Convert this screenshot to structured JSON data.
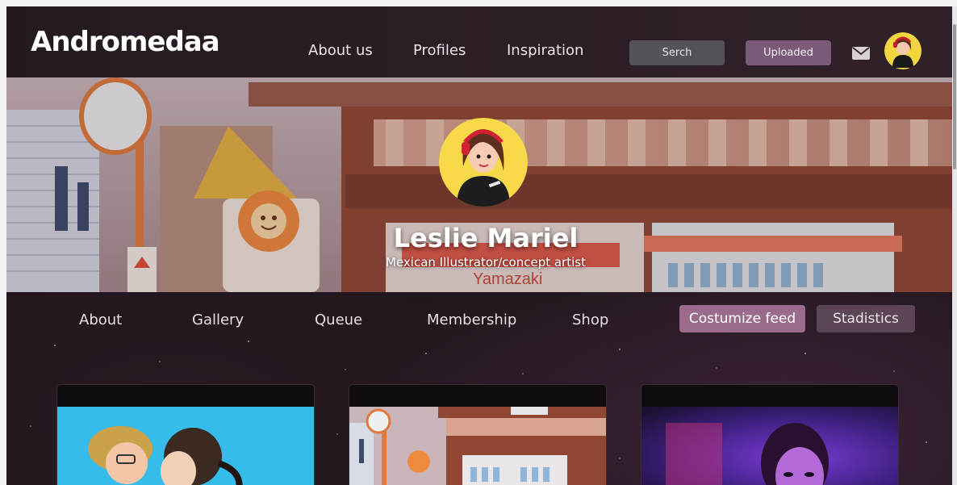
{
  "header": {
    "logo": "Andromedaa",
    "nav": [
      "About us",
      "Profiles",
      "Inspiration"
    ],
    "search_label": "Serch",
    "upload_label": "Uploaded",
    "icons": [
      "mail-icon",
      "user-avatar"
    ]
  },
  "hero": {
    "name": "Leslie Mariel",
    "subtitle": "Mexican Illustrator/concept artist",
    "sign_text": "Yamazaki"
  },
  "profile_nav": {
    "tabs": [
      "About",
      "Gallery",
      "Queue",
      "Membership",
      "Shop"
    ],
    "customize_label": "Costumize feed",
    "stats_label": "Stadistics"
  },
  "gallery": {
    "cards": [
      "kiss-illustration",
      "shop-street-illustration",
      "neon-portrait-illustration"
    ]
  },
  "colors": {
    "background": "#1c1519",
    "accent": "#9a6b8a",
    "button_dark": "#56525a"
  }
}
